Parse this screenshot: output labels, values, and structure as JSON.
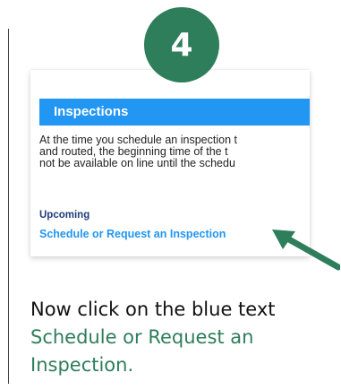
{
  "step": {
    "number": "4",
    "color": "#2e7d5b"
  },
  "panel": {
    "header": "Inspections",
    "header_color": "#2196f3",
    "body_lines": [
      "At the time you schedule an inspection t",
      "and routed, the beginning time of  the t",
      "not be available on line until the schedu"
    ],
    "upcoming_label": "Upcoming",
    "schedule_link": "Schedule or Request an Inspection"
  },
  "arrow": {
    "icon": "arrow-up-left-icon",
    "color": "#2e7d5b"
  },
  "instruction": {
    "prefix": "Now click on the blue text",
    "highlight": "Schedule or Request an Inspection."
  }
}
